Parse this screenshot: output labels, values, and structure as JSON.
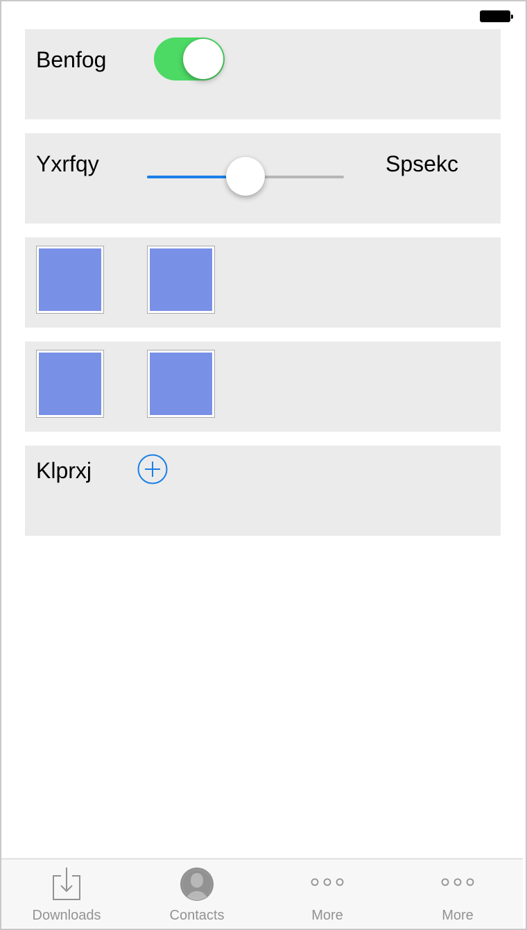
{
  "status_bar": {
    "battery_icon": "battery-full-icon"
  },
  "rows": {
    "toggle_row": {
      "label": "Benfog",
      "toggle_on": true,
      "accent": "#4cd964"
    },
    "slider_row": {
      "min_label": "Yxrfqy",
      "max_label": "Spsekc",
      "value": 0.5,
      "accent": "#1a7fe6"
    },
    "tiles_row_1": {
      "tiles": [
        {
          "color": "#7890e6"
        },
        {
          "color": "#7890e6"
        }
      ]
    },
    "tiles_row_2": {
      "tiles": [
        {
          "color": "#7890e6"
        },
        {
          "color": "#7890e6"
        }
      ]
    },
    "add_row": {
      "label": "Klprxj",
      "add_icon": "plus-circle-icon"
    }
  },
  "tabbar": {
    "tabs": [
      {
        "label": "Downloads",
        "icon": "downloads-icon"
      },
      {
        "label": "Contacts",
        "icon": "contacts-icon"
      },
      {
        "label": "More",
        "icon": "more-icon"
      },
      {
        "label": "More",
        "icon": "more-icon"
      }
    ]
  }
}
